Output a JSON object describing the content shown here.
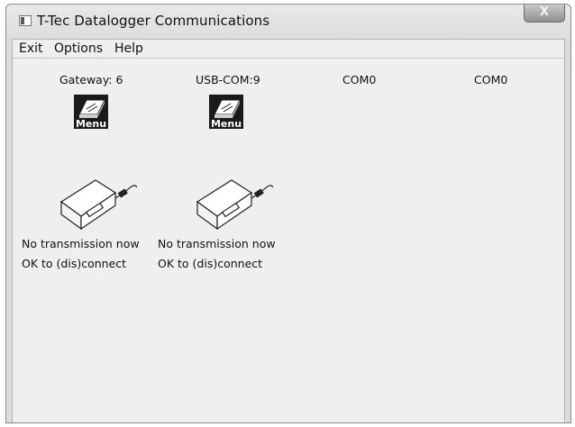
{
  "window": {
    "title": "T-Tec Datalogger Communications",
    "close_symbol": "X"
  },
  "menubar": [
    {
      "label": "Exit"
    },
    {
      "label": "Options"
    },
    {
      "label": "Help"
    }
  ],
  "ports": [
    {
      "label": "Gateway: 6",
      "menu_icon_text": "Menu",
      "status1": "No transmission now",
      "status2": "OK to (dis)connect"
    },
    {
      "label": "USB-COM:9",
      "menu_icon_text": "Menu",
      "status1": "No transmission now",
      "status2": "OK to (dis)connect"
    },
    {
      "label": "COM0"
    },
    {
      "label": "COM0"
    }
  ]
}
